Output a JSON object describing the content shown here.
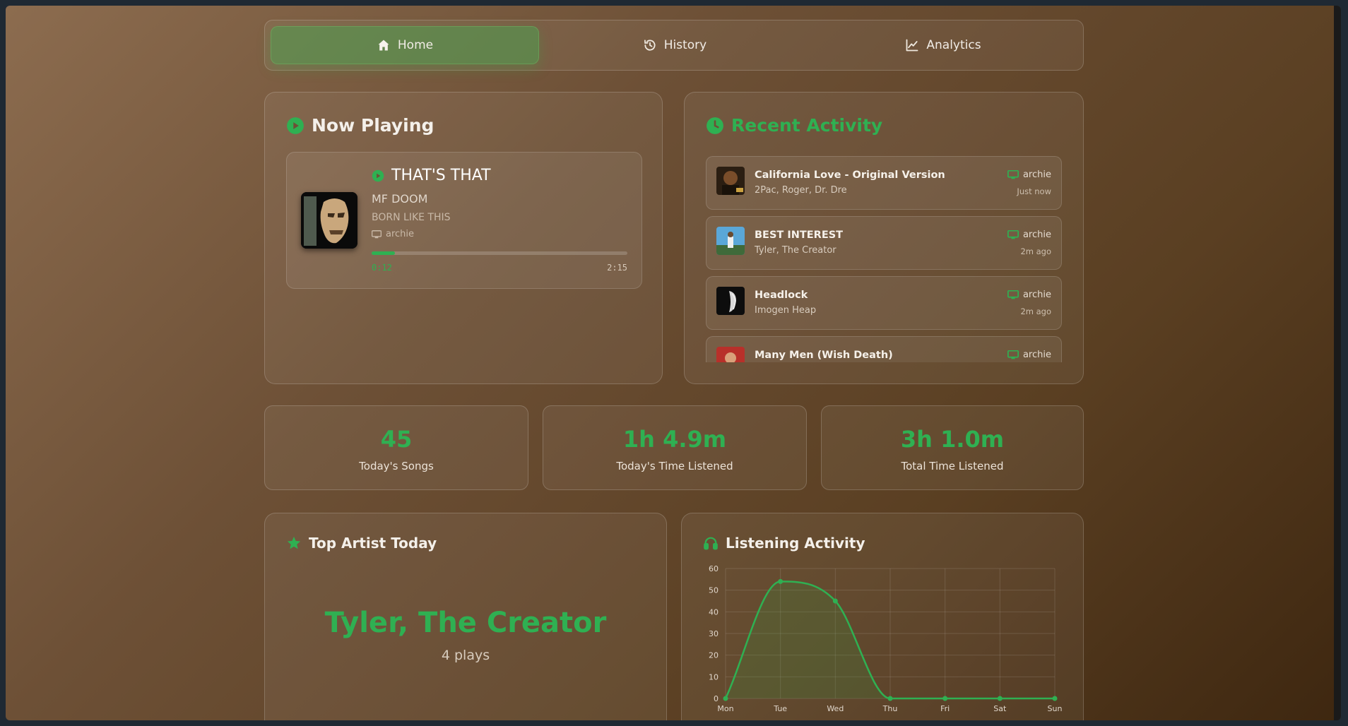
{
  "nav": {
    "tabs": [
      {
        "label": "Home",
        "icon": "home-icon",
        "active": true
      },
      {
        "label": "History",
        "icon": "history-icon",
        "active": false
      },
      {
        "label": "Analytics",
        "icon": "analytics-icon",
        "active": false
      }
    ]
  },
  "now_playing": {
    "heading": "Now Playing",
    "song": "THAT'S THAT",
    "artist": "MF DOOM",
    "album": "BORN LIKE THIS",
    "device": "archie",
    "current_time": "0:12",
    "total_time": "2:15",
    "progress_fraction": 0.09
  },
  "recent": {
    "heading": "Recent Activity",
    "items": [
      {
        "title": "California Love - Original Version",
        "artist": "2Pac, Roger, Dr. Dre",
        "device": "archie",
        "time": "Just now"
      },
      {
        "title": "BEST INTEREST",
        "artist": "Tyler, The Creator",
        "device": "archie",
        "time": "2m ago"
      },
      {
        "title": "Headlock",
        "artist": "Imogen Heap",
        "device": "archie",
        "time": "2m ago"
      },
      {
        "title": "Many Men (Wish Death)",
        "artist": "",
        "device": "archie",
        "time": ""
      }
    ]
  },
  "stats": [
    {
      "value": "45",
      "label": "Today's Songs"
    },
    {
      "value": "1h 4.9m",
      "label": "Today's Time Listened"
    },
    {
      "value": "3h 1.0m",
      "label": "Total Time Listened"
    }
  ],
  "top_artist": {
    "heading": "Top Artist Today",
    "name": "Tyler, The Creator",
    "plays": "4 plays"
  },
  "listening": {
    "heading": "Listening Activity"
  },
  "colors": {
    "accent": "#2fb052",
    "background_start": "#8c6c4f",
    "background_end": "#3e2710"
  },
  "chart_data": {
    "type": "line",
    "categories": [
      "Mon",
      "Tue",
      "Wed",
      "Thu",
      "Fri",
      "Sat",
      "Sun"
    ],
    "series": [
      {
        "values": [
          0,
          54,
          45,
          0,
          0,
          0,
          0
        ]
      }
    ],
    "ylim": [
      0,
      60
    ],
    "yticks": [
      0,
      10,
      20,
      30,
      40,
      50,
      60
    ],
    "grid": true,
    "fill": true
  }
}
